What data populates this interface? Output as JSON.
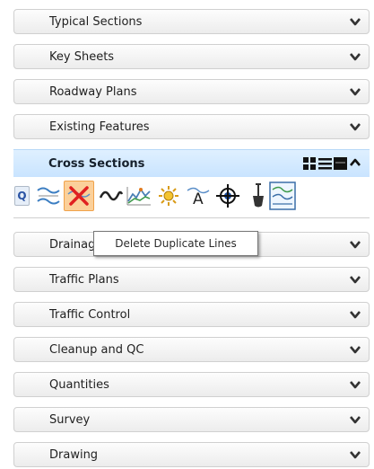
{
  "sections": [
    {
      "label": "Typical Sections"
    },
    {
      "label": "Key Sheets"
    },
    {
      "label": "Roadway Plans"
    },
    {
      "label": "Existing Features"
    }
  ],
  "active_section": {
    "label": "Cross Sections",
    "controls": [
      "grid-view-icon",
      "list-view-icon",
      "single-row-view-icon",
      "chevron-up-icon"
    ],
    "tools": [
      {
        "icon": "q-search-tool-icon",
        "text": "Q"
      },
      {
        "icon": "cross-section-lines-icon"
      },
      {
        "icon": "delete-duplicate-lines-icon",
        "selected": true
      },
      {
        "icon": "curve-line-icon"
      },
      {
        "icon": "terrain-chart-icon"
      },
      {
        "icon": "sun-symbol-icon"
      },
      {
        "icon": "text-annotation-icon"
      },
      {
        "icon": "target-crosshair-icon"
      },
      {
        "icon": "shovel-icon"
      },
      {
        "icon": "cross-section-sheet-icon"
      }
    ]
  },
  "sections_after": [
    {
      "label": "Drainage"
    },
    {
      "label": "Traffic Plans"
    },
    {
      "label": "Traffic Control"
    },
    {
      "label": "Cleanup and QC"
    },
    {
      "label": "Quantities"
    },
    {
      "label": "Survey"
    },
    {
      "label": "Drawing"
    }
  ],
  "tooltip": "Delete Duplicate Lines",
  "colors": {
    "active_header": "#cfe7ff",
    "selected_tool": "#fbd09a",
    "text": "#1f1f1f"
  }
}
